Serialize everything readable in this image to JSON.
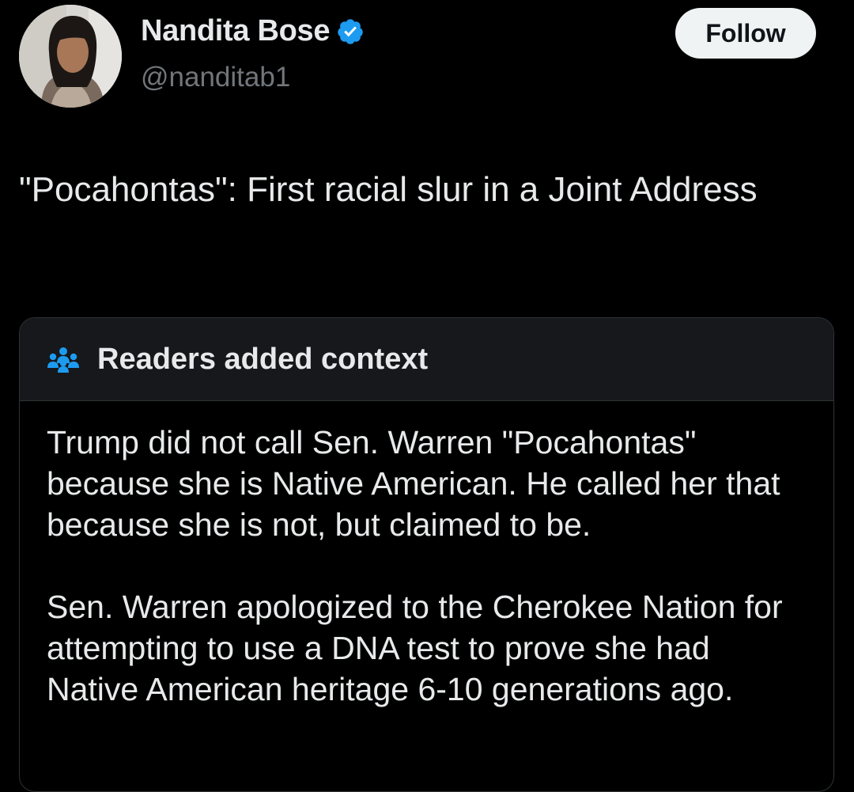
{
  "tweet": {
    "author": {
      "display_name": "Nandita Bose",
      "handle": "@nanditab1",
      "verified_icon": "verified-badge-icon"
    },
    "follow_label": "Follow",
    "text": "\"Pocahontas\": First racial slur in a Joint Address"
  },
  "community_note": {
    "title": "Readers added context",
    "icon": "people-icon",
    "paragraphs": [
      "Trump did not call Sen. Warren \"Pocahontas\" because she is Native American. He called her that because she is not, but claimed to be.",
      "Sen. Warren apologized to the Cherokee Nation for attempting to use a DNA test to prove she had Native American heritage 6-10 generations ago."
    ]
  },
  "colors": {
    "background": "#000000",
    "text_primary": "#e7e9ea",
    "text_secondary": "#71767b",
    "verified_blue": "#1d9bf0",
    "note_header_bg": "#16181c",
    "border": "#2f3336"
  }
}
